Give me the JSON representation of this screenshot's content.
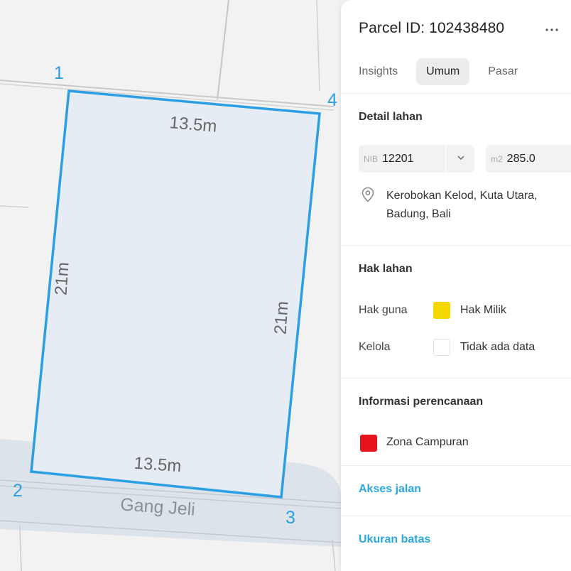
{
  "map": {
    "vertex_labels": [
      "1",
      "2",
      "3",
      "4"
    ],
    "edge_labels": {
      "top": "13.5m",
      "bottom": "13.5m",
      "left": "21m",
      "right": "21m"
    },
    "street_name": "Gang Jeli",
    "parcel_stroke_color": "#2b9fe3",
    "parcel_fill_color": "#e6ecf3",
    "road_color": "#dde3ea"
  },
  "panel": {
    "title": "Parcel ID: 102438480",
    "more_icon": "more-horizontal-icon",
    "tabs": [
      {
        "label": "Insights",
        "active": false
      },
      {
        "label": "Umum",
        "active": true
      },
      {
        "label": "Pasar",
        "active": false
      }
    ],
    "detail": {
      "title": "Detail lahan",
      "nib_prefix": "NIB",
      "nib_value": "12201",
      "area_prefix": "m2",
      "area_value": "285.0",
      "address_line1": "Kerobokan Kelod, Kuta Utara,",
      "address_line2": "Badung, Bali"
    },
    "rights": {
      "title": "Hak lahan",
      "hak_guna_label": "Hak guna",
      "hak_guna_value": "Hak Milik",
      "hak_guna_color": "#f5d800",
      "kelola_label": "Kelola",
      "kelola_value": "Tidak ada data"
    },
    "planning": {
      "title": "Informasi perencanaan",
      "zone_label": "Zona Campuran",
      "zone_color": "#e8141c"
    },
    "links": {
      "road_access": "Akses jalan",
      "boundary_size": "Ukuran batas"
    }
  }
}
